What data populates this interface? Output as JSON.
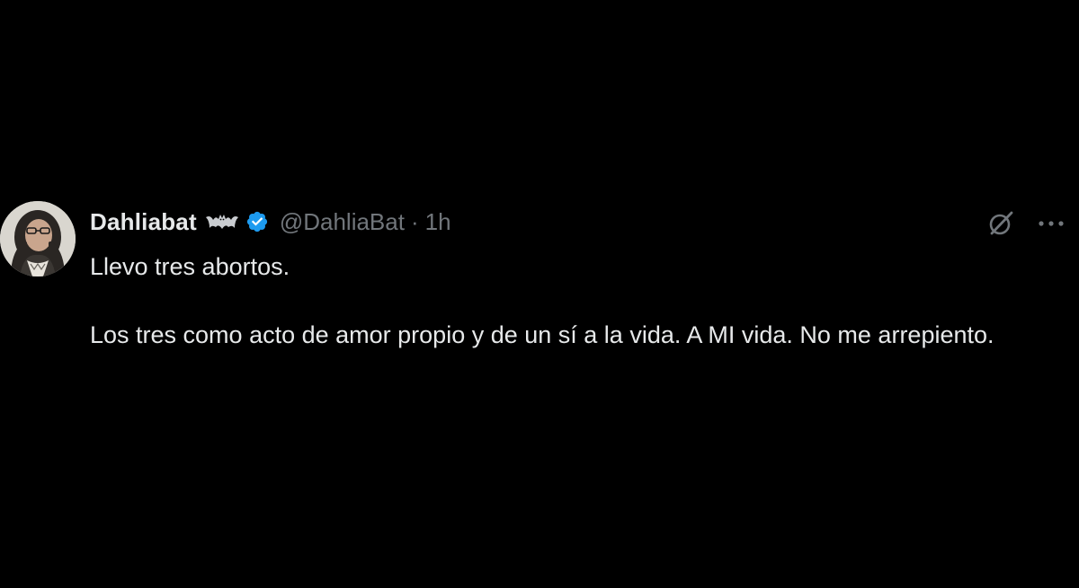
{
  "tweet": {
    "author": {
      "display_name": "Dahliabat",
      "handle": "@DahliaBat",
      "verified": true,
      "verified_color": "#1d9bf0",
      "badge_emoji": "bat-emoji"
    },
    "separator": "·",
    "timestamp": "1h",
    "paragraphs": [
      "Llevo tres abortos.",
      "Los tres como acto de amor propio y de un sí a la vida. A MI vida. No me arrepiento."
    ],
    "actions": {
      "grok_icon": "grok-icon",
      "more_icon": "more-icon"
    }
  },
  "colors": {
    "background": "#000000",
    "text_primary": "#e7e9ea",
    "text_secondary": "#71767b",
    "accent": "#1d9bf0"
  }
}
